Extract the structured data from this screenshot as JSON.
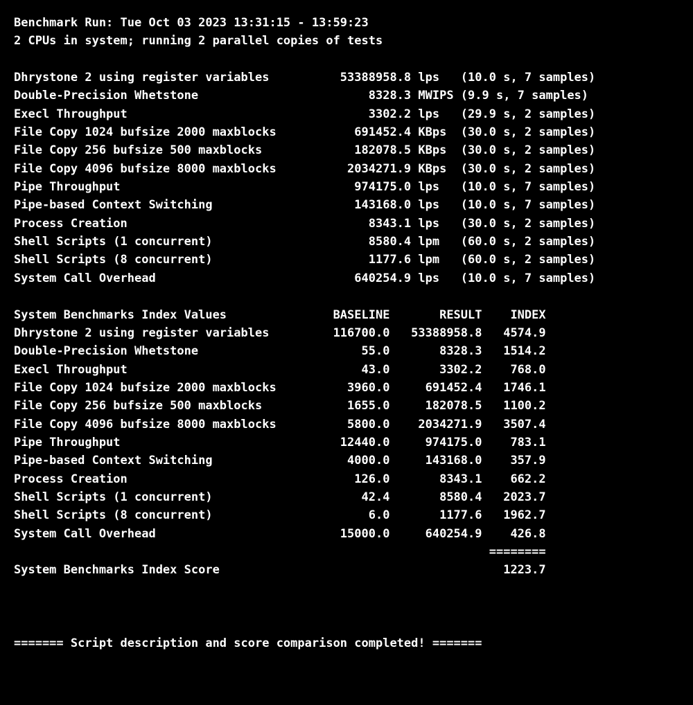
{
  "header": {
    "run_line": "Benchmark Run: Tue Oct 03 2023 13:31:15 - 13:59:23",
    "cpu_line": "2 CPUs in system; running 2 parallel copies of tests"
  },
  "results": [
    {
      "name": "Dhrystone 2 using register variables",
      "value": "53388958.8",
      "unit": "lps",
      "time": "10.0",
      "samples": "7"
    },
    {
      "name": "Double-Precision Whetstone",
      "value": "8328.3",
      "unit": "MWIPS",
      "time": "9.9",
      "samples": "7"
    },
    {
      "name": "Execl Throughput",
      "value": "3302.2",
      "unit": "lps",
      "time": "29.9",
      "samples": "2"
    },
    {
      "name": "File Copy 1024 bufsize 2000 maxblocks",
      "value": "691452.4",
      "unit": "KBps",
      "time": "30.0",
      "samples": "2"
    },
    {
      "name": "File Copy 256 bufsize 500 maxblocks",
      "value": "182078.5",
      "unit": "KBps",
      "time": "30.0",
      "samples": "2"
    },
    {
      "name": "File Copy 4096 bufsize 8000 maxblocks",
      "value": "2034271.9",
      "unit": "KBps",
      "time": "30.0",
      "samples": "2"
    },
    {
      "name": "Pipe Throughput",
      "value": "974175.0",
      "unit": "lps",
      "time": "10.0",
      "samples": "7"
    },
    {
      "name": "Pipe-based Context Switching",
      "value": "143168.0",
      "unit": "lps",
      "time": "10.0",
      "samples": "7"
    },
    {
      "name": "Process Creation",
      "value": "8343.1",
      "unit": "lps",
      "time": "30.0",
      "samples": "2"
    },
    {
      "name": "Shell Scripts (1 concurrent)",
      "value": "8580.4",
      "unit": "lpm",
      "time": "60.0",
      "samples": "2"
    },
    {
      "name": "Shell Scripts (8 concurrent)",
      "value": "1177.6",
      "unit": "lpm",
      "time": "60.0",
      "samples": "2"
    },
    {
      "name": "System Call Overhead",
      "value": "640254.9",
      "unit": "lps",
      "time": "10.0",
      "samples": "7"
    }
  ],
  "index_header": {
    "title": "System Benchmarks Index Values",
    "baseline": "BASELINE",
    "result": "RESULT",
    "index": "INDEX"
  },
  "index_rows": [
    {
      "name": "Dhrystone 2 using register variables",
      "baseline": "116700.0",
      "result": "53388958.8",
      "index": "4574.9"
    },
    {
      "name": "Double-Precision Whetstone",
      "baseline": "55.0",
      "result": "8328.3",
      "index": "1514.2"
    },
    {
      "name": "Execl Throughput",
      "baseline": "43.0",
      "result": "3302.2",
      "index": "768.0"
    },
    {
      "name": "File Copy 1024 bufsize 2000 maxblocks",
      "baseline": "3960.0",
      "result": "691452.4",
      "index": "1746.1"
    },
    {
      "name": "File Copy 256 bufsize 500 maxblocks",
      "baseline": "1655.0",
      "result": "182078.5",
      "index": "1100.2"
    },
    {
      "name": "File Copy 4096 bufsize 8000 maxblocks",
      "baseline": "5800.0",
      "result": "2034271.9",
      "index": "3507.4"
    },
    {
      "name": "Pipe Throughput",
      "baseline": "12440.0",
      "result": "974175.0",
      "index": "783.1"
    },
    {
      "name": "Pipe-based Context Switching",
      "baseline": "4000.0",
      "result": "143168.0",
      "index": "357.9"
    },
    {
      "name": "Process Creation",
      "baseline": "126.0",
      "result": "8343.1",
      "index": "662.2"
    },
    {
      "name": "Shell Scripts (1 concurrent)",
      "baseline": "42.4",
      "result": "8580.4",
      "index": "2023.7"
    },
    {
      "name": "Shell Scripts (8 concurrent)",
      "baseline": "6.0",
      "result": "1177.6",
      "index": "1962.7"
    },
    {
      "name": "System Call Overhead",
      "baseline": "15000.0",
      "result": "640254.9",
      "index": "426.8"
    }
  ],
  "separator_line": "                                                                   ========",
  "score": {
    "label": "System Benchmarks Index Score",
    "value": "1223.7"
  },
  "footer": "======= Script description and score comparison completed! ======="
}
